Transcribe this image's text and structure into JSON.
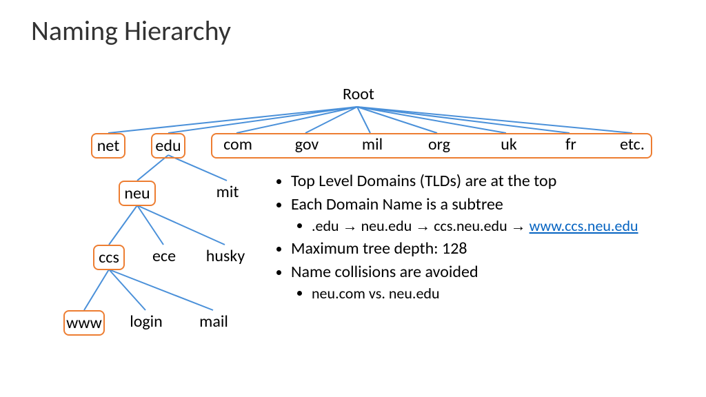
{
  "title": "Naming Hierarchy",
  "tree": {
    "root": "Root",
    "tlds": [
      "net",
      "edu",
      "com",
      "gov",
      "mil",
      "org",
      "uk",
      "fr",
      "etc."
    ],
    "edu_children": [
      "neu",
      "mit"
    ],
    "neu_children": [
      "ccs",
      "ece",
      "husky"
    ],
    "ccs_children": [
      "www",
      "login",
      "mail"
    ]
  },
  "bullets": {
    "b1": "Top Level Domains (TLDs) are at the top",
    "b2": "Each Domain Name is a subtree",
    "b2a_pre": ".edu ",
    "b2a_arrow": "→",
    "b2a_mid1": " neu.edu ",
    "b2a_mid2": " ccs.neu.edu ",
    "b2a_link": "www.ccs.neu.edu",
    "b3": "Maximum tree depth: 128",
    "b4": "Name collisions are avoided",
    "b4a": "neu.com vs. neu.edu"
  }
}
